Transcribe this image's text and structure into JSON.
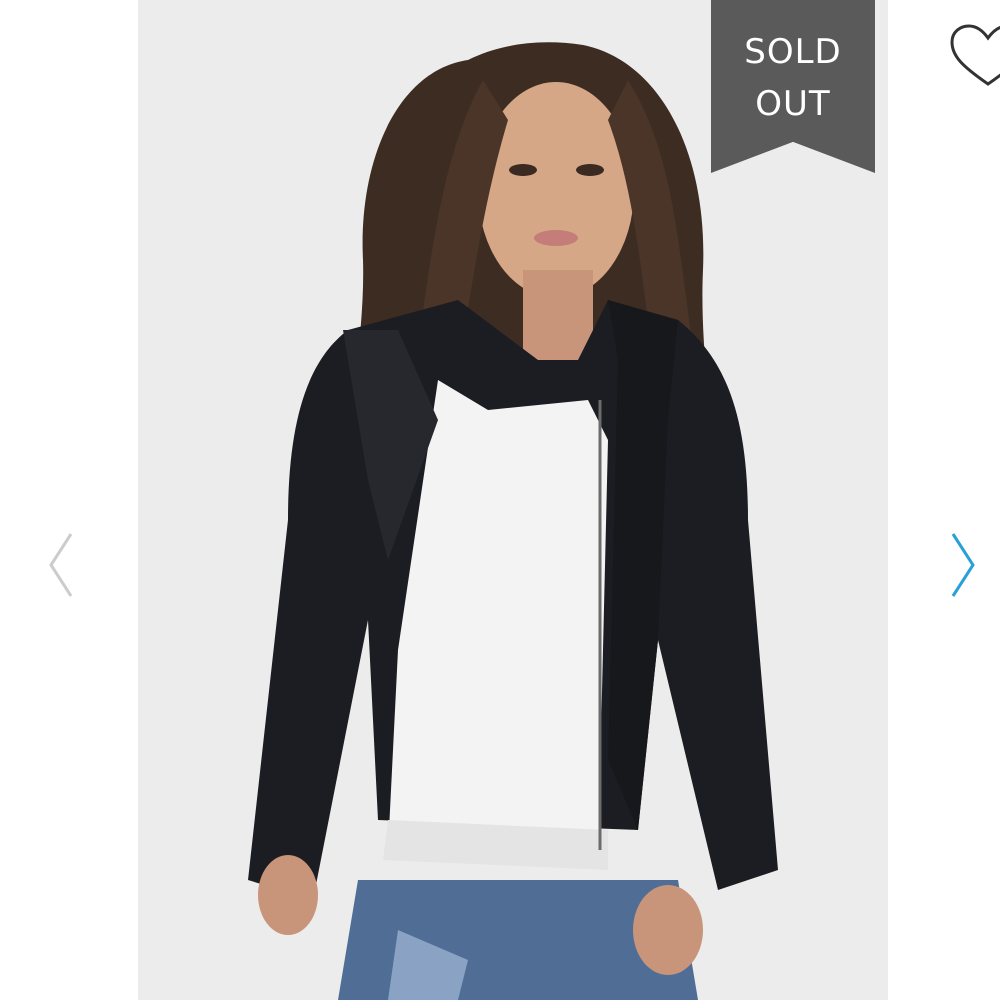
{
  "product": {
    "badge_text": "SOLD\nOUT",
    "badge_color": "#5a5a5a",
    "photo_background": "#ececec"
  },
  "favorite": {
    "icon": "heart-outline-icon"
  },
  "carousel": {
    "prev_icon": "chevron-left-icon",
    "next_icon": "chevron-right-icon",
    "prev_color": "#cccccc",
    "next_color": "#2a9fd8"
  }
}
